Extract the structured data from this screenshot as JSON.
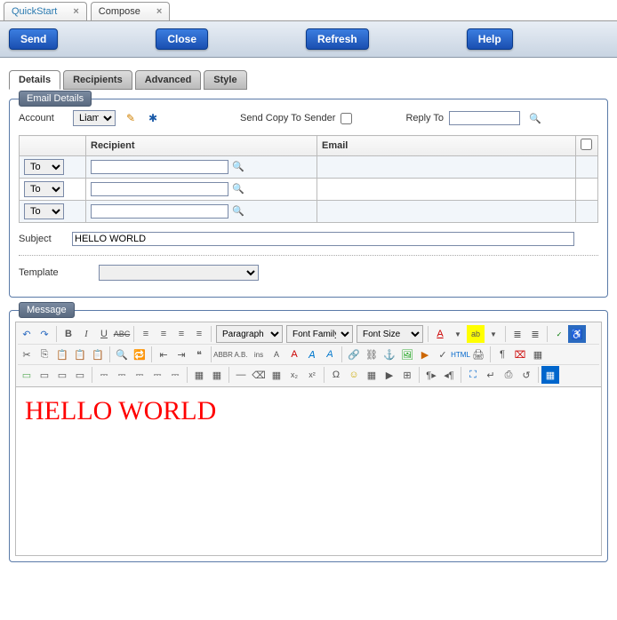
{
  "tabs": {
    "quickstart": "QuickStart",
    "compose": "Compose"
  },
  "toolbar": {
    "send": "Send",
    "close": "Close",
    "refresh": "Refresh",
    "help": "Help"
  },
  "subtabs": {
    "details": "Details",
    "recipients": "Recipients",
    "advanced": "Advanced",
    "style": "Style"
  },
  "emailDetails": {
    "legend": "Email Details",
    "accountLabel": "Account",
    "accountValue": "Liam",
    "sendCopyLabel": "Send Copy To Sender",
    "replyToLabel": "Reply To",
    "replyToValue": "",
    "table": {
      "h_to": "",
      "h_recipient": "Recipient",
      "h_email": "Email",
      "rows": [
        {
          "type": "To",
          "recipient": "",
          "email": ""
        },
        {
          "type": "To",
          "recipient": "",
          "email": ""
        },
        {
          "type": "To",
          "recipient": "",
          "email": ""
        }
      ]
    },
    "subjectLabel": "Subject",
    "subjectValue": "HELLO WORLD",
    "templateLabel": "Template",
    "templateValue": ""
  },
  "message": {
    "legend": "Message",
    "paragraphLabel": "Paragraph",
    "fontFamilyLabel": "Font Family",
    "fontSizeLabel": "Font Size",
    "body": "HELLO WORLD"
  }
}
